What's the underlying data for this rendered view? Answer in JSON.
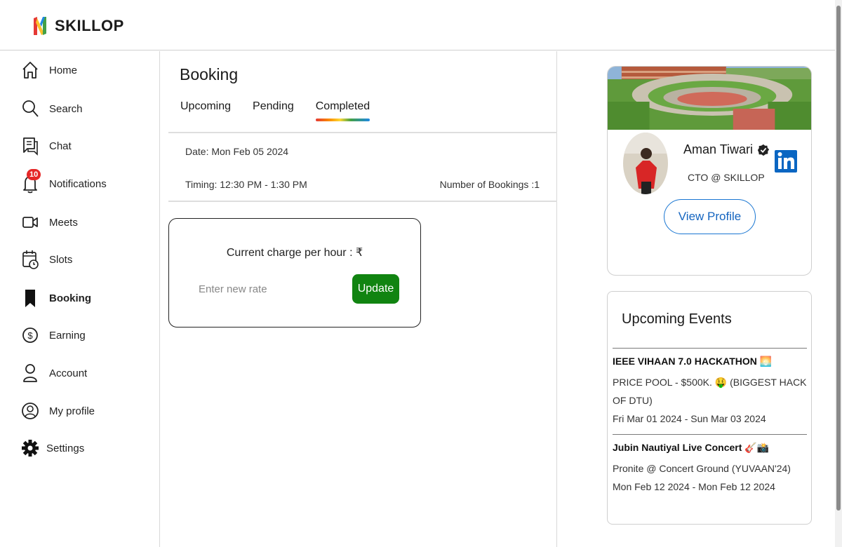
{
  "app": {
    "name": "SKILLOP"
  },
  "sidebar": {
    "items": [
      {
        "label": "Home",
        "icon": "home-icon"
      },
      {
        "label": "Search",
        "icon": "search-icon"
      },
      {
        "label": "Chat",
        "icon": "chat-icon"
      },
      {
        "label": "Notifications",
        "icon": "bell-icon",
        "badge": "10"
      },
      {
        "label": "Meets",
        "icon": "video-icon"
      },
      {
        "label": "Slots",
        "icon": "calendar-clock-icon"
      },
      {
        "label": "Booking",
        "icon": "bookmark-icon",
        "active": true
      },
      {
        "label": "Earning",
        "icon": "dollar-icon"
      },
      {
        "label": "Account",
        "icon": "account-icon"
      },
      {
        "label": "My profile",
        "icon": "profile-icon"
      },
      {
        "label": "Settings",
        "icon": "gear-icon"
      }
    ]
  },
  "main": {
    "title": "Booking",
    "tabs": [
      {
        "label": "Upcoming"
      },
      {
        "label": "Pending"
      },
      {
        "label": "Completed",
        "active": true
      }
    ],
    "booking": {
      "date": "Date: Mon Feb 05 2024",
      "timing": "Timing: 12:30 PM - 1:30 PM",
      "count": "Number of Bookings :1"
    },
    "rate": {
      "title": "Current charge per hour : ₹",
      "placeholder": "Enter new rate",
      "button": "Update"
    }
  },
  "profile": {
    "name": "Aman Tiwari",
    "role": "CTO @ SKILLOP",
    "button": "View Profile"
  },
  "events": {
    "title": "Upcoming Events",
    "items": [
      {
        "name": "IEEE VIHAAN 7.0 HACKATHON 🌅",
        "desc": "PRICE POOL - $500K. 🤑 (BIGGEST HACK OF DTU)",
        "date": "Fri Mar 01 2024 - Sun Mar 03 2024"
      },
      {
        "name": "Jubin Nautiyal Live Concert 🎸📸",
        "desc": "Pronite @ Concert Ground (YUVAAN'24)",
        "date": "Mon Feb 12 2024 - Mon Feb 12 2024"
      }
    ]
  },
  "colors": {
    "accent_green": "#118411",
    "link_blue": "#1565c0",
    "badge_red": "#e52727"
  }
}
